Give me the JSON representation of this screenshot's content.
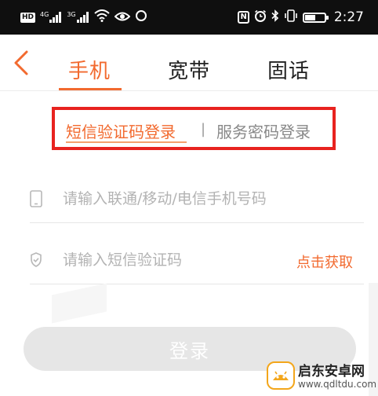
{
  "status_bar": {
    "hd_badge": "HD",
    "signal1_label": "4G",
    "signal2_label": "3G",
    "time": "2:27",
    "nfc_label": "N",
    "battery_level": 0.55,
    "icons": [
      "hd-icon",
      "signal-icon",
      "signal-icon",
      "wifi-icon",
      "eye-icon",
      "circle-icon",
      "nfc-icon",
      "alarm-icon",
      "bluetooth-icon",
      "vibrate-icon",
      "battery-icon"
    ]
  },
  "header": {
    "back_icon": "chevron-left-icon",
    "tabs": [
      {
        "label": "手机",
        "active": true
      },
      {
        "label": "宽带",
        "active": false
      },
      {
        "label": "固话",
        "active": false
      }
    ]
  },
  "login_types": {
    "sms_label": "短信验证码登录",
    "separator": "|",
    "password_label": "服务密码登录",
    "highlight_color": "#e8231f"
  },
  "form": {
    "phone": {
      "icon": "phone-icon",
      "placeholder": "请输入联通/移动/电信手机号码",
      "value": ""
    },
    "code": {
      "icon": "shield-icon",
      "placeholder": "请输入短信验证码",
      "value": "",
      "get_code_label": "点击获取"
    },
    "login_button": "登录"
  },
  "colors": {
    "accent": "#f26a2f",
    "disabled_button": "#e6e6e6"
  },
  "watermark": {
    "title": "启东安卓网",
    "url": "www.qdltdu.com"
  }
}
